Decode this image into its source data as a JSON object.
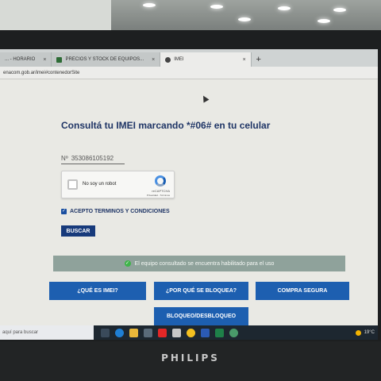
{
  "monitor": {
    "brand": "PHILIPS"
  },
  "browser": {
    "tabs": [
      {
        "label": "... - HORARIO",
        "active": false
      },
      {
        "label": "PRECIOS Y STOCK DE EQUIPOS...",
        "active": false
      },
      {
        "label": "IMEI",
        "active": true
      }
    ],
    "new_tab_symbol": "+",
    "close_symbol": "×",
    "url": "enacom.gob.ar/imei#contenedorSite"
  },
  "page": {
    "title": "Consultá tu IMEI marcando *#06# en tu celular",
    "imei_input": {
      "prefix": "Nº",
      "value": "353086105192"
    },
    "captcha": {
      "label": "No soy un robot",
      "brand": "reCAPTCHA",
      "links": "Privacidad - Términos"
    },
    "terms": {
      "label": "ACEPTO TERMINOS Y CONDICIONES",
      "checked": true,
      "check_symbol": "✓"
    },
    "search_button": "BUSCAR",
    "status": {
      "text": "El equipo consultado se encuentra habilitado para el uso",
      "icon_symbol": "✓"
    },
    "nav_buttons": [
      "¿QUÉ ES IMEI?",
      "¿POR QUÉ SE BLOQUEA?",
      "COMPRA SEGURA",
      "BLOQUEO/DESBLOQUEO"
    ]
  },
  "taskbar": {
    "search_placeholder": "aquí para buscar",
    "temperature": "19°C",
    "icons": [
      "task-view-icon",
      "edge-icon",
      "file-explorer-icon",
      "store-icon",
      "youtube-icon",
      "app-icon",
      "chrome-icon",
      "word-icon",
      "excel-icon",
      "app-icon"
    ]
  },
  "colors": {
    "navy": "#173a7b",
    "button_blue": "#1d5fb0",
    "status_bg": "#8fa29b",
    "title": "#1f3566"
  }
}
